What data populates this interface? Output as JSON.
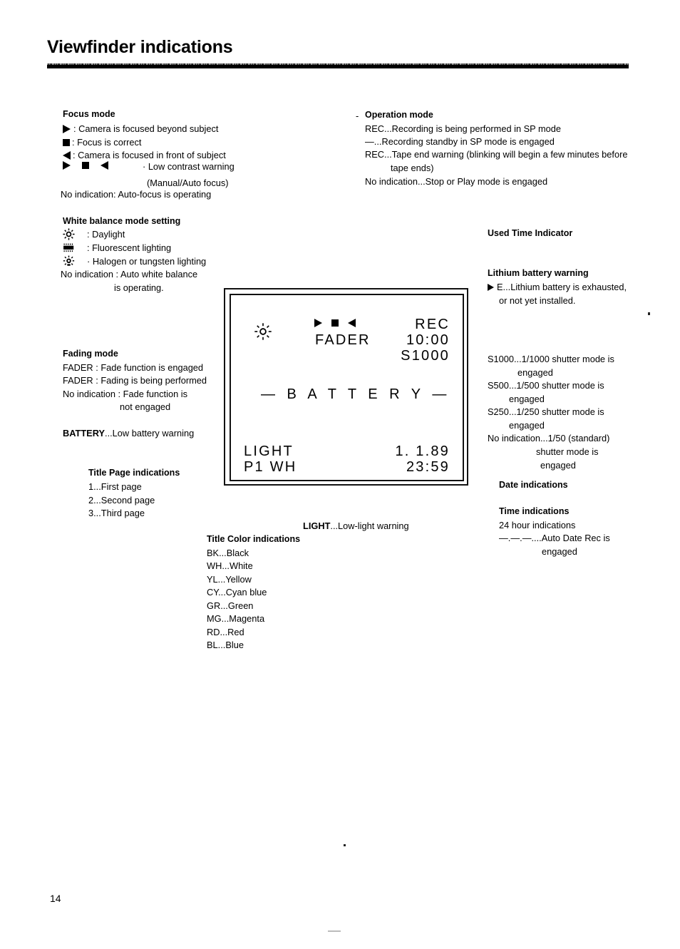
{
  "page": {
    "title": "Viewfinder indications",
    "number": "14"
  },
  "focus_mode": {
    "heading": "Focus mode",
    "items": [
      {
        "icon": "right-triangle-icon",
        "text": ": Camera is focused beyond subject"
      },
      {
        "icon": "filled-square-icon",
        "text": ": Focus is correct"
      },
      {
        "icon": "left-triangle-icon",
        "text": ": Camera is focused in front of subject"
      }
    ],
    "low_contrast_label": "· Low contrast warning",
    "manual_auto_label": "(Manual/Auto focus)",
    "no_indication": "No indication: Auto-focus is operating"
  },
  "operation_mode": {
    "heading": "Operation mode",
    "lines": [
      "REC...Recording is being performed in SP mode",
      "—...Recording standby in SP mode is engaged",
      "REC...Tape end warning (blinking will begin a few minutes before",
      "tape ends)",
      "No indication...Stop or Play mode is engaged"
    ]
  },
  "white_balance": {
    "heading": "White balance mode setting",
    "items": [
      {
        "icon": "daylight-sun-icon",
        "text": ": Daylight"
      },
      {
        "icon": "fluorescent-tube-icon",
        "text": ": Fluorescent lighting"
      },
      {
        "icon": "halogen-bulb-icon",
        "text": "· Halogen or tungsten lighting"
      }
    ],
    "no_indication_1": "No indication : Auto white balance",
    "no_indication_2": "is operating."
  },
  "fading_mode": {
    "heading": "Fading mode",
    "lines": [
      "FADER : Fade function is engaged",
      "FADER : Fading is being performed",
      "No indication : Fade function is",
      "not engaged"
    ],
    "battery_warning_bold": "BATTERY",
    "battery_warning_rest": "...Low battery warning"
  },
  "title_page": {
    "heading": "Title Page indications",
    "items": [
      "1...First page",
      "2...Second page",
      "3...Third page"
    ]
  },
  "light_caption": {
    "bold": "LIGHT",
    "rest": "...Low-light warning"
  },
  "title_color": {
    "heading": "Title Color indications",
    "items": [
      "BK...Black",
      "WH...White",
      "YL...Yellow",
      "CY...Cyan blue",
      "GR...Green",
      "MG...Magenta",
      "RD...Red",
      "BL...Blue"
    ]
  },
  "used_time": {
    "heading": "Used Time Indicator"
  },
  "lithium_battery": {
    "heading": "Lithium battery warning",
    "line_1": "E...Lithium battery is exhausted,",
    "line_2": "or not yet installed.",
    "marker_icon": "right-triangle-icon"
  },
  "shutter_modes": {
    "lines": [
      "S1000...1/1000 shutter mode is",
      "engaged",
      "S500...1/500 shutter mode is",
      "engaged",
      "S250...1/250 shutter mode is",
      "engaged",
      "No indication...1/50 (standard)",
      "shutter mode is",
      "engaged"
    ]
  },
  "date_indications": {
    "heading": "Date indications"
  },
  "time_indications": {
    "heading": "Time indications",
    "line_1": "24 hour indications",
    "line_2": "—.—.—....Auto Date Rec is",
    "line_3": "engaged"
  },
  "viewfinder": {
    "sun_icon": "daylight-sun-icon",
    "focus_symbols": [
      "right-triangle-icon",
      "filled-square-icon",
      "left-triangle-icon"
    ],
    "fader": "FADER",
    "rec": "REC",
    "counter": "10:00",
    "shutter": "S1000",
    "battery": "— B A T T E R Y —",
    "light": "LIGHT",
    "title_page_color": "P1 WH",
    "date": "1. 1.89",
    "time": "23:59"
  }
}
